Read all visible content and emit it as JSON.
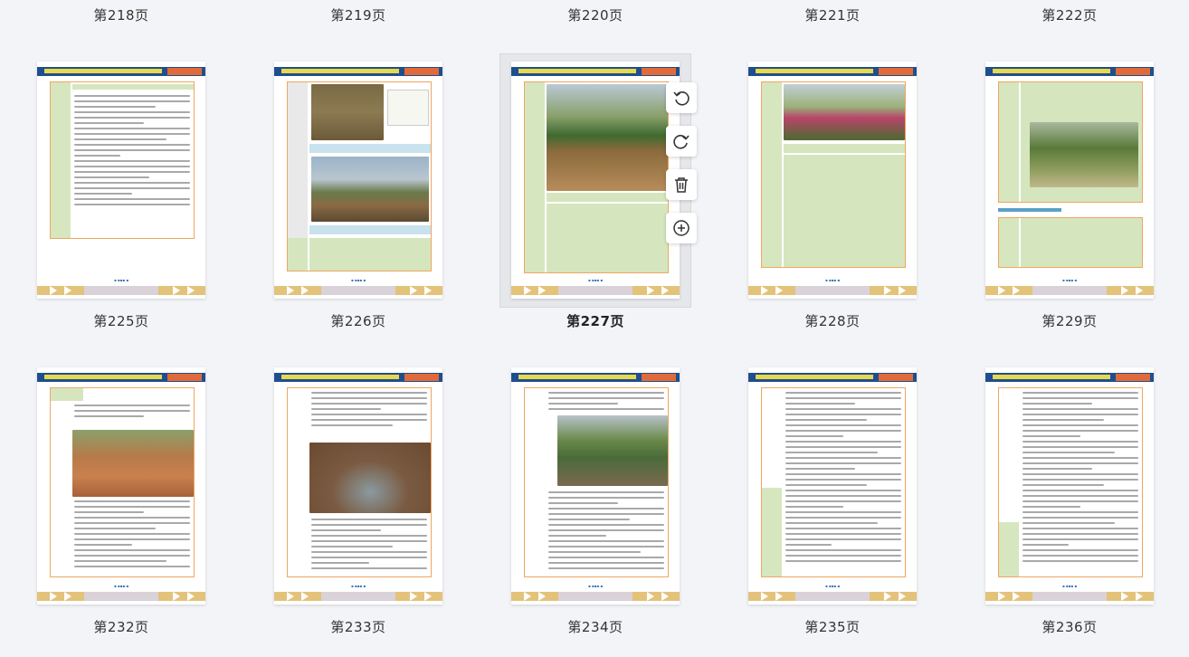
{
  "top_row_labels": [
    "第218页",
    "第219页",
    "第220页",
    "第221页",
    "第222页"
  ],
  "row1_labels": [
    "第225页",
    "第226页",
    "第227页",
    "第228页",
    "第229页"
  ],
  "row2_labels": [
    "第232页",
    "第233页",
    "第234页",
    "第235页",
    "第236页"
  ],
  "selected_page": "第227页",
  "toolbar": {
    "rotate_left_icon": "rotate-ccw-icon",
    "rotate_right_icon": "rotate-cw-icon",
    "delete_icon": "trash-icon",
    "insert_icon": "plus-circle-icon"
  },
  "colors": {
    "header_blue": "#1f4e8f",
    "header_title_yellow": "#e8d84c",
    "header_num_orange": "#e06a3a",
    "table_green": "#d5e6be",
    "table_border": "#f0a660",
    "footer_gold": "#e3c27a",
    "background": "#f3f4f7"
  }
}
